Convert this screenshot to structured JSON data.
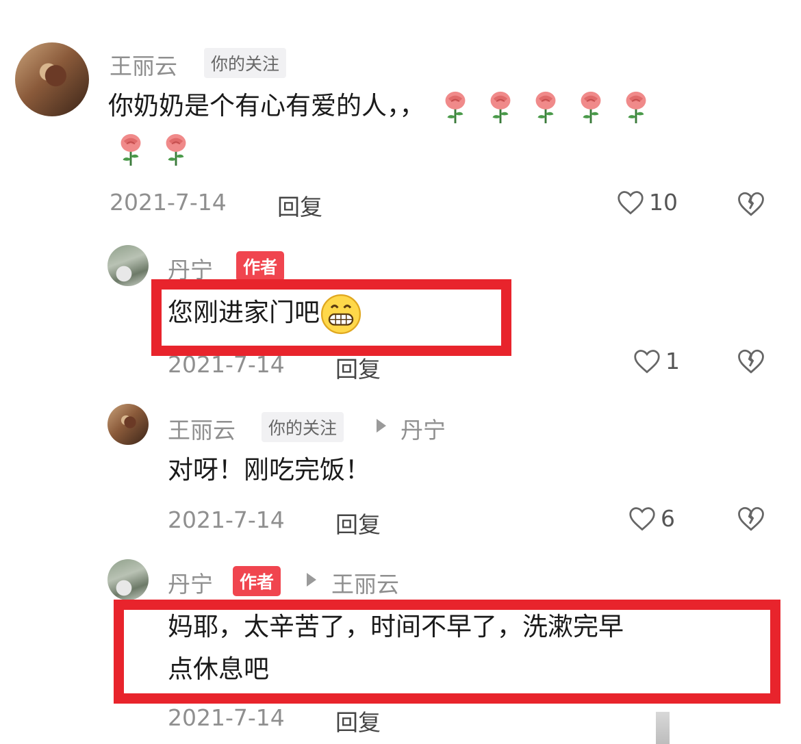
{
  "comments": [
    {
      "author": "王丽云",
      "badge": "你的关注",
      "text": "你奶奶是个有心有爱的人，，",
      "roses": 7,
      "date": "2021-7-14",
      "reply": "回复",
      "likes": "10"
    },
    {
      "author": "丹宁",
      "badge": "作者",
      "text": "您刚进家门吧",
      "date": "2021-7-14",
      "reply": "回复",
      "likes": "1"
    },
    {
      "author": "王丽云",
      "badge": "你的关注",
      "reply_to": "丹宁",
      "text": "对呀！刚吃完饭！",
      "date": "2021-7-14",
      "reply": "回复",
      "likes": "6"
    },
    {
      "author": "丹宁",
      "badge": "作者",
      "reply_to": "王丽云",
      "text_line1": "妈耶，太辛苦了，时间不早了，洗漱完早",
      "text_line2": "点休息吧",
      "date": "2021-7-14",
      "reply": "回复"
    }
  ],
  "colors": {
    "highlight": "#e8242c",
    "author_badge": "#f0454f"
  },
  "icons": [
    "heart-icon",
    "broken-heart-icon",
    "rose-emoji",
    "grin-emoji",
    "reply-arrow-icon"
  ]
}
